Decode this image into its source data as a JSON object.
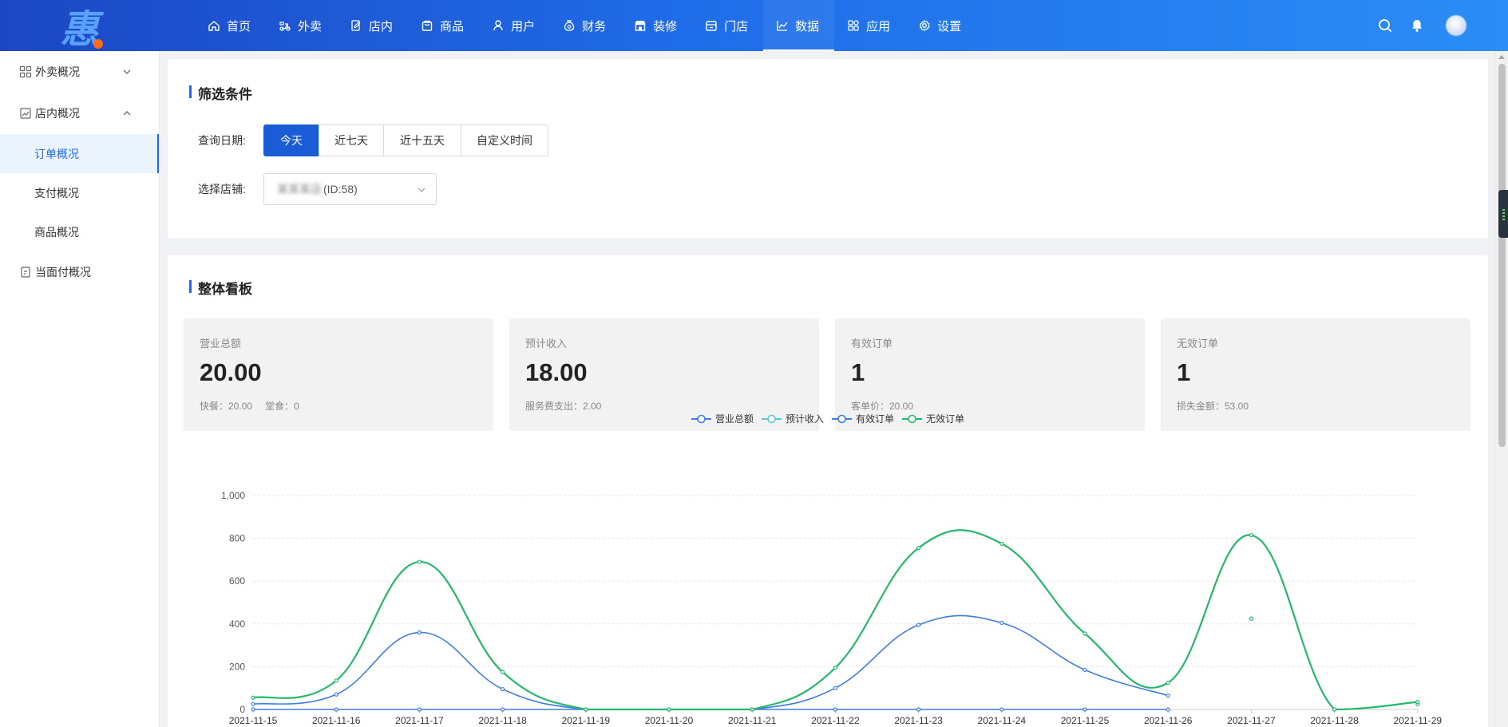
{
  "logo": {
    "char": "惠"
  },
  "nav": {
    "items": [
      {
        "label": "首页",
        "icon": "home-icon"
      },
      {
        "label": "外卖",
        "icon": "scooter-icon"
      },
      {
        "label": "店内",
        "icon": "edit-icon"
      },
      {
        "label": "商品",
        "icon": "bag-icon"
      },
      {
        "label": "用户",
        "icon": "user-icon"
      },
      {
        "label": "财务",
        "icon": "money-bag-icon"
      },
      {
        "label": "装修",
        "icon": "store-icon"
      },
      {
        "label": "门店",
        "icon": "shop-icon"
      },
      {
        "label": "数据",
        "icon": "chart-icon",
        "active": true
      },
      {
        "label": "应用",
        "icon": "apps-icon"
      },
      {
        "label": "设置",
        "icon": "gear-icon"
      }
    ],
    "right_icons": [
      "search-icon",
      "bell-icon",
      "avatar"
    ]
  },
  "sidebar": {
    "groups": [
      {
        "label": "外卖概况",
        "icon": "grid-icon",
        "expanded": false,
        "children": []
      },
      {
        "label": "店内概况",
        "icon": "chart-box-icon",
        "expanded": true,
        "children": [
          {
            "label": "订单概况",
            "active": true
          },
          {
            "label": "支付概况"
          },
          {
            "label": "商品概况"
          }
        ]
      },
      {
        "label": "当面付概况",
        "icon": "doc-icon",
        "expanded": false,
        "children": []
      }
    ]
  },
  "filter": {
    "title": "筛选条件",
    "date_label": "查询日期:",
    "date_options": [
      "今天",
      "近七天",
      "近十五天",
      "自定义时间"
    ],
    "date_selected": "今天",
    "store_label": "选择店铺:",
    "store_name_blurred": "某某某店",
    "store_id": "(ID:58)"
  },
  "board": {
    "title": "整体看板",
    "stats": [
      {
        "label": "营业总额",
        "value": "20.00",
        "subs": [
          "快餐：20.00",
          "堂食：0"
        ]
      },
      {
        "label": "预计收入",
        "value": "18.00",
        "subs": [
          "服务费支出：2.00"
        ]
      },
      {
        "label": "有效订单",
        "value": "1",
        "subs": [
          "客单价：20.00"
        ]
      },
      {
        "label": "无效订单",
        "value": "1",
        "subs": [
          "损失金额：53.00"
        ]
      }
    ]
  },
  "colors": {
    "accent": "#1f6ce8",
    "blue_series": "#3d7de0",
    "cyan_series": "#5bc4d6",
    "green_series": "#25b86c"
  },
  "chart_data": {
    "type": "line",
    "categories": [
      "2021-11-15",
      "2021-11-16",
      "2021-11-17",
      "2021-11-18",
      "2021-11-19",
      "2021-11-20",
      "2021-11-21",
      "2021-11-22",
      "2021-11-23",
      "2021-11-24",
      "2021-11-25",
      "2021-11-26",
      "2021-11-27",
      "2021-11-28",
      "2021-11-29"
    ],
    "ylim": [
      0,
      1000
    ],
    "yticks": [
      "0",
      "200",
      "400",
      "600",
      "800",
      "1,000"
    ],
    "grid": true,
    "legend": "top-center",
    "series": [
      {
        "name": "营业总额",
        "color": "#3d7de0",
        "values": [
          25,
          70,
          360,
          95,
          0,
          0,
          0,
          100,
          395,
          405,
          185,
          65,
          null,
          null,
          null
        ]
      },
      {
        "name": "预计收入",
        "color": "#5bc4d6",
        "values": [
          null,
          null,
          null,
          null,
          null,
          null,
          null,
          null,
          null,
          null,
          null,
          null,
          425,
          0,
          25
        ]
      },
      {
        "name": "有效订单",
        "color": "#3d7de0",
        "values": [
          0,
          0,
          0,
          0,
          0,
          0,
          0,
          0,
          0,
          0,
          0,
          0,
          null,
          null,
          null
        ]
      },
      {
        "name": "无效订单",
        "color": "#25b86c",
        "values": [
          55,
          135,
          690,
          175,
          0,
          0,
          0,
          195,
          755,
          775,
          355,
          125,
          815,
          0,
          35
        ]
      }
    ]
  }
}
